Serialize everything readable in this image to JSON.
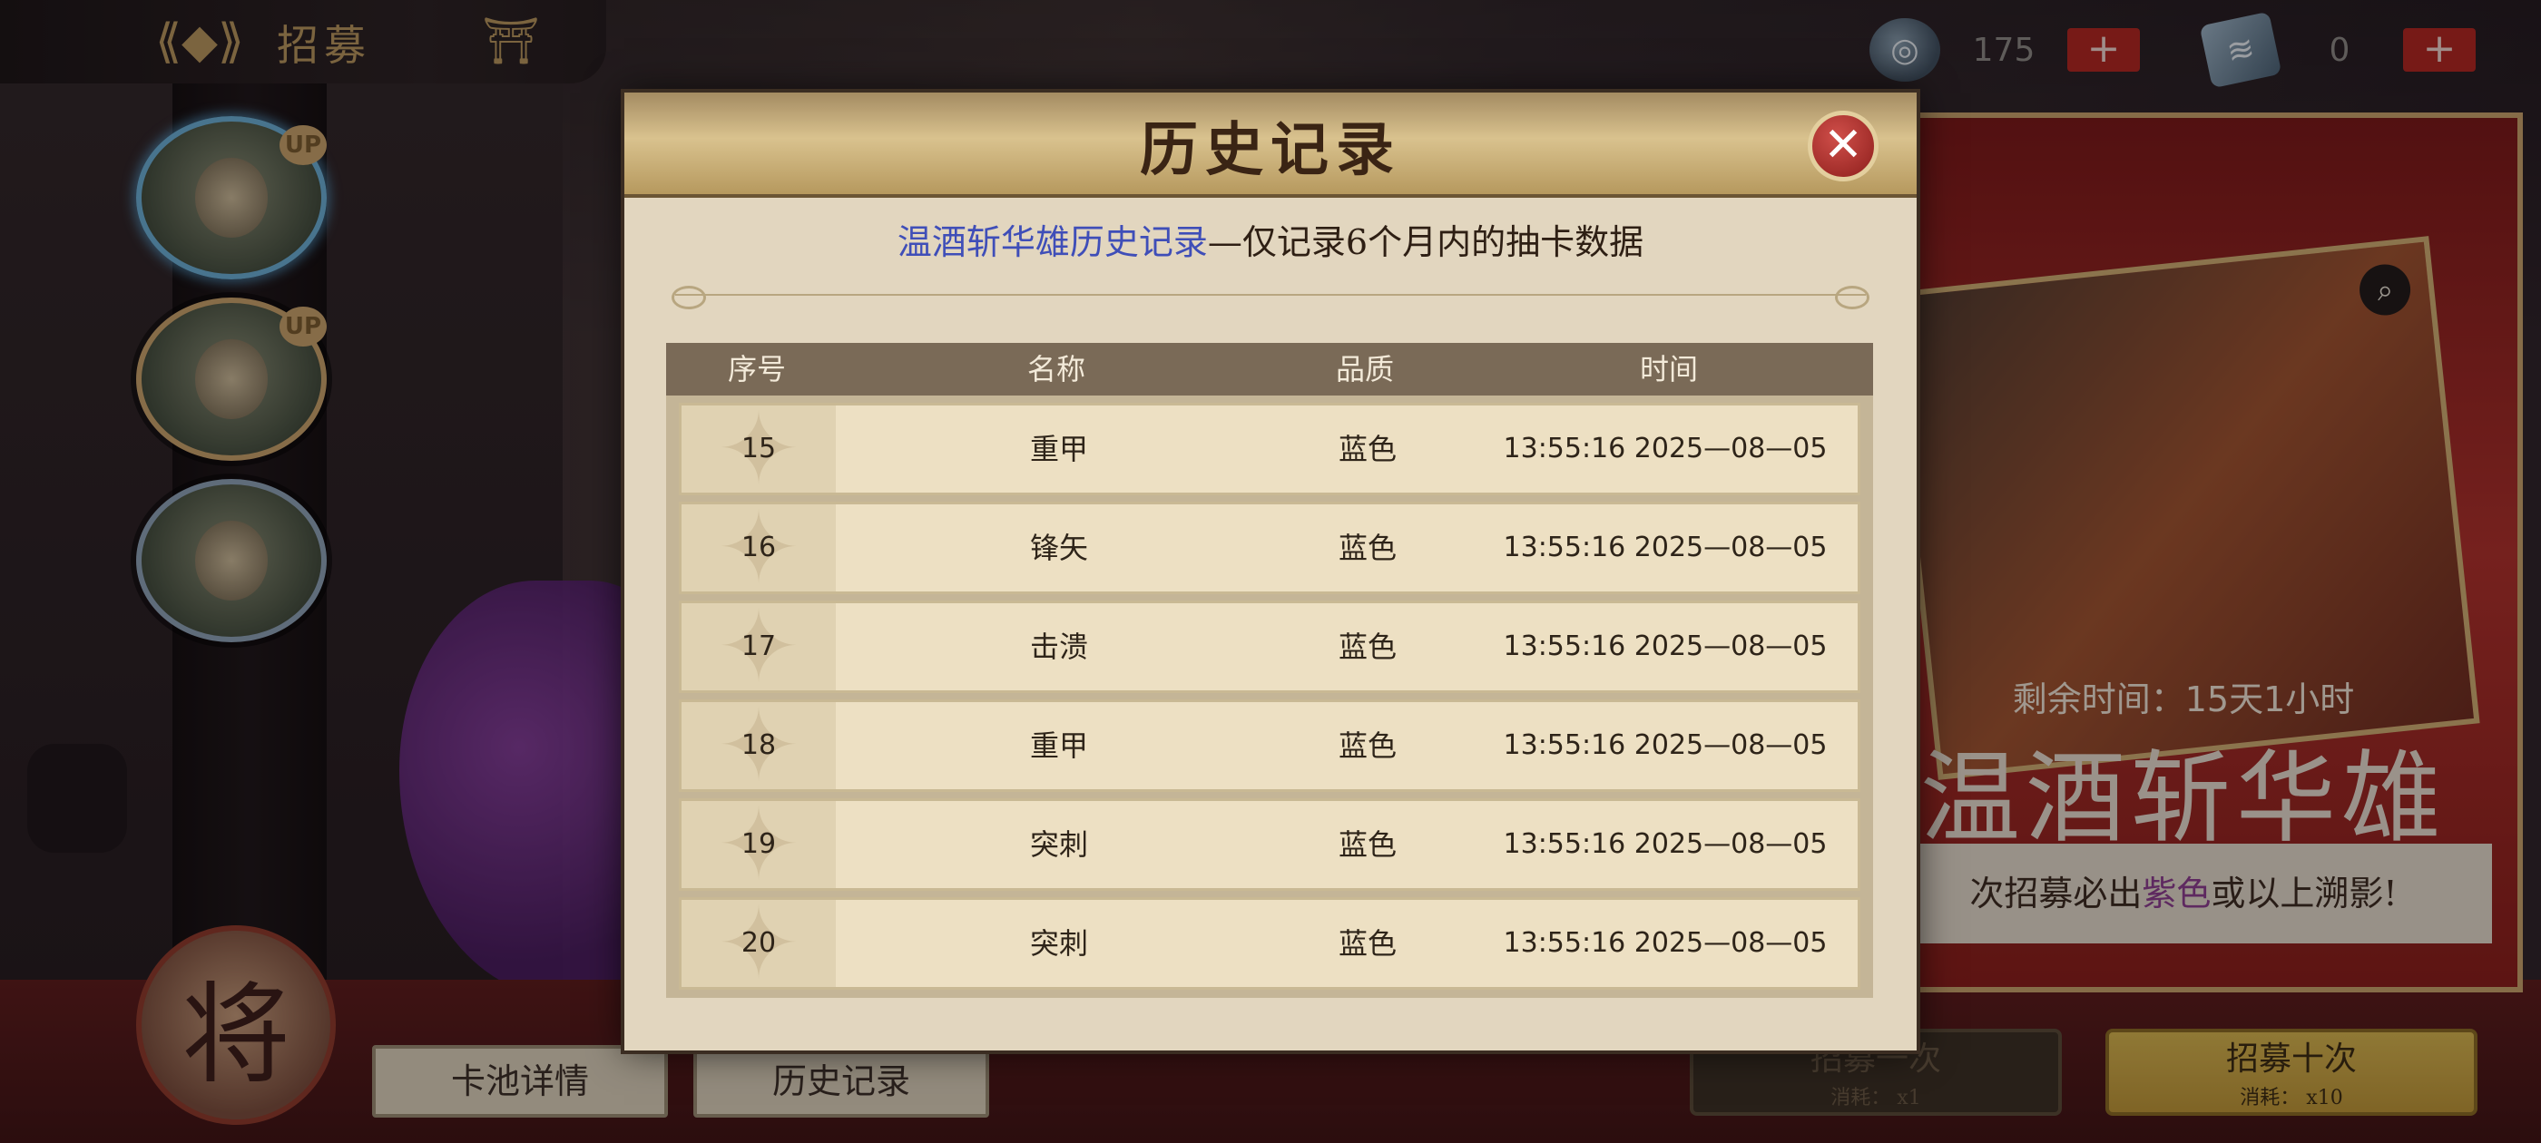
{
  "topbar": {
    "title": "招募",
    "back_icon": "arrow-left-icon",
    "pavilion_icon": "pavilion-icon"
  },
  "currencies": [
    {
      "icon": "jade-token-icon",
      "value": "175"
    },
    {
      "icon": "recruit-ticket-icon",
      "value": "0"
    }
  ],
  "heroes": [
    {
      "badge": "UP",
      "selected": true
    },
    {
      "badge": "UP",
      "selected": false
    },
    {
      "badge": "",
      "selected": false
    }
  ],
  "general_emblem": "将",
  "bottom_buttons": {
    "pool_details": "卡池详情",
    "history": "历史记录"
  },
  "banner": {
    "remaining": "剩余时间：15天1小时",
    "name": "温酒斩华雄",
    "promise_prefix": "次招募必出",
    "promise_color_word": "紫色",
    "promise_suffix": "或以上溯影!"
  },
  "recruit": {
    "one": {
      "label": "招募一次",
      "cost": "消耗：  x1"
    },
    "ten": {
      "label": "招募十次",
      "cost": "消耗：  x10"
    }
  },
  "modal": {
    "title": "历史记录",
    "subtitle_blue": "温酒斩华雄历史记录",
    "subtitle_rest": "—仅记录6个月内的抽卡数据",
    "columns": [
      "序号",
      "名称",
      "品质",
      "时间"
    ],
    "rows": [
      {
        "idx": "15",
        "name": "重甲",
        "quality": "蓝色",
        "time": "13:55:16 2025—08—05"
      },
      {
        "idx": "16",
        "name": "锋矢",
        "quality": "蓝色",
        "time": "13:55:16 2025—08—05"
      },
      {
        "idx": "17",
        "name": "击溃",
        "quality": "蓝色",
        "time": "13:55:16 2025—08—05"
      },
      {
        "idx": "18",
        "name": "重甲",
        "quality": "蓝色",
        "time": "13:55:16 2025—08—05"
      },
      {
        "idx": "19",
        "name": "突刺",
        "quality": "蓝色",
        "time": "13:55:16 2025—08—05"
      },
      {
        "idx": "20",
        "name": "突刺",
        "quality": "蓝色",
        "time": "13:55:16 2025—08—05"
      }
    ]
  }
}
